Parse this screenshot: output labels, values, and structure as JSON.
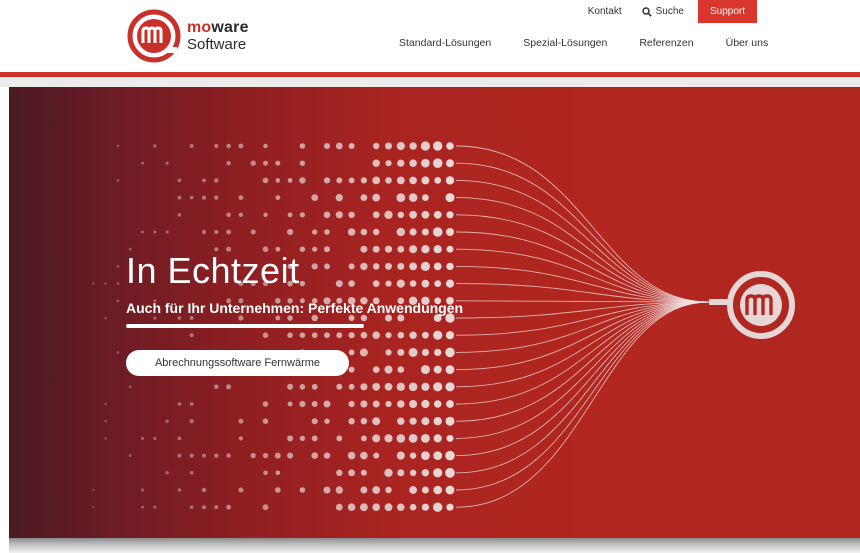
{
  "brand": {
    "name_prefix": "mo",
    "name_suffix": "ware",
    "tagline": "Software",
    "color_primary": "#d7372d"
  },
  "topbar": {
    "contact_label": "Kontakt",
    "search_label": "Suche",
    "search_icon": "search-icon",
    "support_label": "Support"
  },
  "nav": {
    "items": [
      {
        "label": "Standard-Lösungen"
      },
      {
        "label": "Spezial-Lösungen"
      },
      {
        "label": "Referenzen"
      },
      {
        "label": "Über uns"
      }
    ]
  },
  "hero": {
    "title": "In Echtzeit",
    "subtitle": "Auch für Ihr Unternehmen: Perfekte Anwendungen",
    "cta_label": "Abrechnungssoftware Fernwärme",
    "background_color": "#b0271f"
  }
}
